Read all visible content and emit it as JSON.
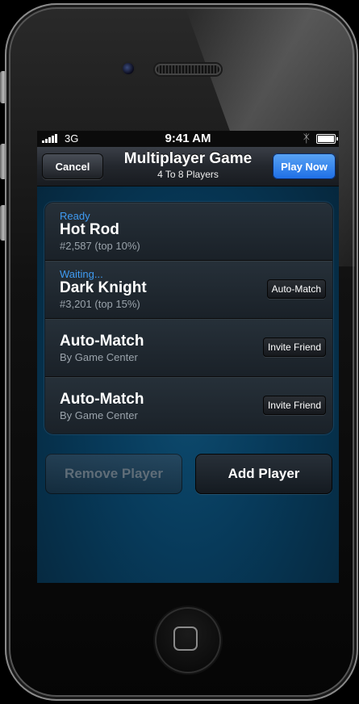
{
  "status_bar": {
    "carrier": "3G",
    "time": "9:41 AM"
  },
  "nav": {
    "cancel_label": "Cancel",
    "title": "Multiplayer Game",
    "subtitle": "4 To 8 Players",
    "play_label": "Play Now"
  },
  "players": [
    {
      "status": "Ready",
      "name": "Hot Rod",
      "detail": "#2,587 (top 10%)",
      "action": ""
    },
    {
      "status": "Waiting...",
      "name": "Dark Knight",
      "detail": "#3,201 (top 15%)",
      "action": "Auto-Match"
    },
    {
      "status": "",
      "name": "Auto-Match",
      "detail": "By Game Center",
      "action": "Invite Friend"
    },
    {
      "status": "",
      "name": "Auto-Match",
      "detail": "By Game Center",
      "action": "Invite Friend"
    }
  ],
  "buttons": {
    "remove_label": "Remove Player",
    "add_label": "Add Player"
  },
  "colors": {
    "accent": "#3f9bf2",
    "play_button": "#2a7ef0"
  },
  "icons": [
    "signal-icon",
    "bluetooth-icon",
    "battery-icon",
    "home-button-icon"
  ]
}
